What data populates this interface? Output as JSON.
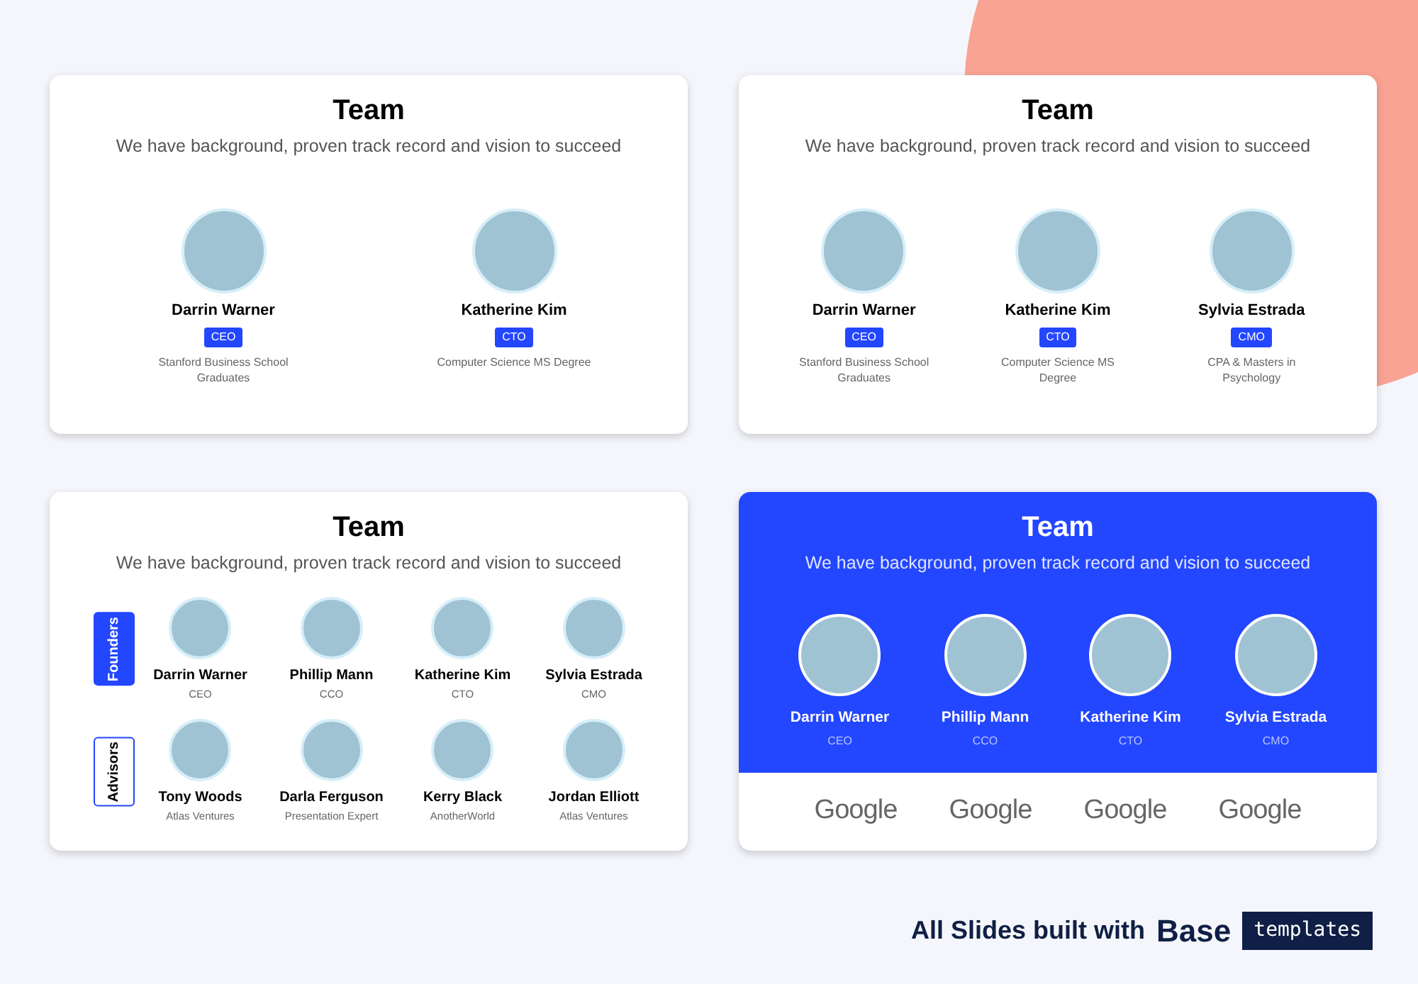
{
  "slides": [
    {
      "kind": "bios",
      "title": "Team",
      "subtitle": "We have background, proven track record and vision to succeed",
      "members": [
        {
          "name": "Darrin Warner",
          "role": "CEO",
          "note": "Stanford Business School Graduates"
        },
        {
          "name": "Katherine Kim",
          "role": "CTO",
          "note": "Computer Science MS Degree"
        }
      ]
    },
    {
      "kind": "bios",
      "title": "Team",
      "subtitle": "We have background, proven track record and vision to succeed",
      "members": [
        {
          "name": "Darrin Warner",
          "role": "CEO",
          "note": "Stanford Business School Graduates"
        },
        {
          "name": "Katherine Kim",
          "role": "CTO",
          "note": "Computer Science MS Degree"
        },
        {
          "name": "Sylvia Estrada",
          "role": "CMO",
          "note": "CPA & Masters in Psychology"
        }
      ]
    },
    {
      "kind": "groups",
      "title": "Team",
      "subtitle": "We have background, proven track record and vision to succeed",
      "groups": [
        {
          "label": "Founders",
          "highlighted": true,
          "members": [
            {
              "name": "Darrin Warner",
              "role": "CEO"
            },
            {
              "name": "Phillip Mann",
              "role": "CCO"
            },
            {
              "name": "Katherine Kim",
              "role": "CTO"
            },
            {
              "name": "Sylvia Estrada",
              "role": "CMO"
            }
          ]
        },
        {
          "label": "Advisors",
          "highlighted": false,
          "members": [
            {
              "name": "Tony Woods",
              "role": "Atlas Ventures"
            },
            {
              "name": "Darla Ferguson",
              "role": "Presentation Expert"
            },
            {
              "name": "Kerry Black",
              "role": "AnotherWorld"
            },
            {
              "name": "Jordan Elliott",
              "role": "Atlas Ventures"
            }
          ]
        }
      ]
    },
    {
      "kind": "banner",
      "title": "Team",
      "subtitle": "We have background, proven track record and vision to succeed",
      "members": [
        {
          "name": "Darrin Warner",
          "role": "CEO"
        },
        {
          "name": "Phillip Mann",
          "role": "CCO"
        },
        {
          "name": "Katherine Kim",
          "role": "CTO"
        },
        {
          "name": "Sylvia Estrada",
          "role": "CMO"
        }
      ],
      "logos": [
        "Google",
        "Google",
        "Google",
        "Google"
      ]
    }
  ],
  "footer": {
    "text": "All Slides built with",
    "brand": "Base",
    "badge": "templates"
  }
}
